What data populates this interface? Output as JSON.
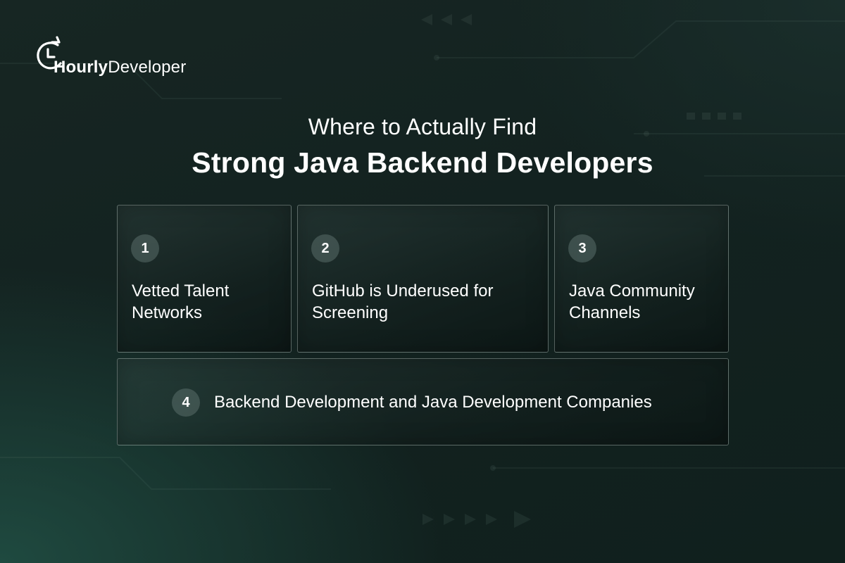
{
  "brand": {
    "name_bold": "Hourly",
    "name_light": "Developer",
    "icon": "clock-refresh-icon"
  },
  "heading": {
    "subtitle": "Where to Actually Find",
    "title": "Strong Java Backend Developers"
  },
  "cards": [
    {
      "number": "1",
      "label": "Vetted Talent\nNetworks"
    },
    {
      "number": "2",
      "label": "GitHub is Underused for\nScreening"
    },
    {
      "number": "3",
      "label": "Java Community\nChannels"
    },
    {
      "number": "4",
      "label": "Backend Development and Java Development Companies"
    }
  ],
  "colors": {
    "background": "#142522",
    "text": "#ffffff",
    "badge": "#56706b",
    "card_border": "#c8d8d3"
  }
}
